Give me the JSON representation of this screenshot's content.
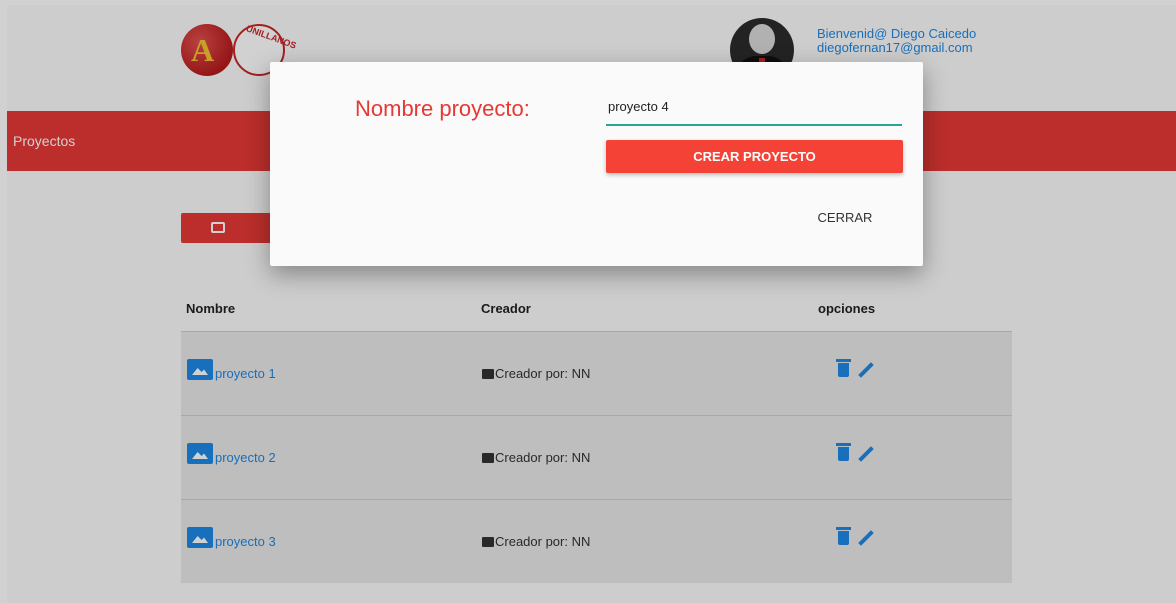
{
  "header": {
    "logo_left_text": "A",
    "logo_right_text": "UNILLANOS",
    "welcome": "Bienvenid@ Diego Caicedo",
    "email": "diegofernan17@gmail.com"
  },
  "nav": {
    "title": "Proyectos"
  },
  "table": {
    "columns": [
      "Nombre",
      "Creador",
      "opciones"
    ],
    "rows": [
      {
        "name": "proyecto 1",
        "creator": "Creador por: NN"
      },
      {
        "name": "proyecto 2",
        "creator": "Creador por: NN"
      },
      {
        "name": "proyecto 3",
        "creator": "Creador por: NN"
      }
    ]
  },
  "modal": {
    "label": "Nombre proyecto:",
    "input_value": "proyecto 4",
    "create_label": "CREAR PROYECTO",
    "close_label": "CERRAR"
  },
  "colors": {
    "primary_red": "#e53935",
    "link_blue": "#1e88e5",
    "input_underline": "#26a69a"
  }
}
